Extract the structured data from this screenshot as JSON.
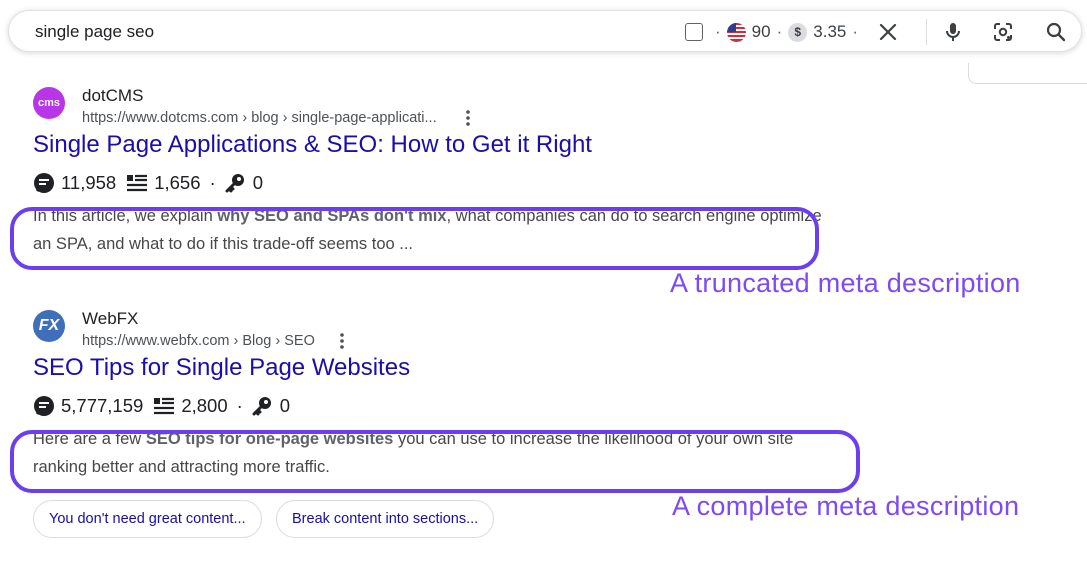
{
  "search": {
    "query": "single page seo",
    "flag_value": "90",
    "coin_symbol": "$",
    "coin_value": "3.35",
    "sep_dot": "·"
  },
  "results": [
    {
      "site_name": "dotCMS",
      "favicon_text": "cms",
      "favicon_color": "#b935e8",
      "url": "https://www.dotcms.com › blog › single-page-applicati...",
      "title": "Single Page Applications & SEO: How to Get it Right",
      "metric_views": "11,958",
      "metric_words": "1,656",
      "metric_keys": "0",
      "snippet_pre": "In this article, we explain ",
      "snippet_bold": "why SEO and SPAs don't mix",
      "snippet_post": ", what companies can do to search engine optimize an SPA, and what to do if this trade-off seems too ...",
      "annotation": "A truncated meta description"
    },
    {
      "site_name": "WebFX",
      "favicon_text": "FX",
      "favicon_color": "#3e6fb8",
      "url": "https://www.webfx.com › Blog › SEO",
      "title": "SEO Tips for Single Page Websites",
      "metric_views": "5,777,159",
      "metric_words": "2,800",
      "metric_keys": "0",
      "snippet_pre": "Here are a few ",
      "snippet_bold": "SEO tips for one-page websites",
      "snippet_post": " you can use to increase the likelihood of your own site ranking better and attracting more traffic.",
      "annotation": "A complete meta description"
    }
  ],
  "chips": [
    "You don't need great content...",
    "Break content into sections..."
  ],
  "colors": {
    "link": "#1a0dab",
    "annotation": "#7d4af5",
    "highlight_border": "#6b3ff0"
  },
  "icons": [
    "checkbox-icon",
    "us-flag-icon",
    "dollar-coin-icon",
    "close-icon",
    "mic-icon",
    "lens-icon",
    "search-icon",
    "kebab-menu-icon",
    "views-icon",
    "words-icon",
    "key-icon"
  ]
}
